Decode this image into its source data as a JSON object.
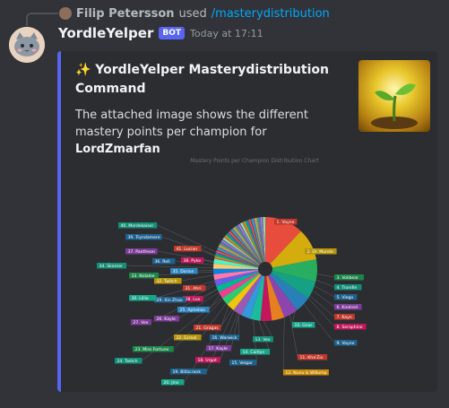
{
  "reply": {
    "user": "Filip Petersson",
    "used": "used",
    "command": "/masterydistribution"
  },
  "message": {
    "username": "YordleYelper",
    "badge": "BOT",
    "timestamp": "Today at 17:11"
  },
  "embed": {
    "accent_color": "#5865f2",
    "title": "✨ YordleYelper Masterydistribution Command",
    "description_prefix": "The attached image shows the different mastery points per champion for ",
    "summoner": "LordZmarfan"
  },
  "chart_data": {
    "type": "pie",
    "title": "Mastery Points per Champion Distribution Chart",
    "labels": [
      {
        "text": "1. Vayne",
        "color": "#c0392b"
      },
      {
        "text": "2. Dr. Mundo",
        "color": "#b7950b"
      },
      {
        "text": "3. Volibear",
        "color": "#1e8449"
      },
      {
        "text": "4. Trundle",
        "color": "#148f77"
      },
      {
        "text": "5. Viego",
        "color": "#1f618d"
      },
      {
        "text": "6. Kindred",
        "color": "#7d3c98"
      },
      {
        "text": "7. Kayn",
        "color": "#c0392b"
      },
      {
        "text": "8. Seraphine",
        "color": "#c2185b"
      },
      {
        "text": "9. Vayne",
        "color": "#1f618d"
      },
      {
        "text": "10. Gnar",
        "color": "#17a589"
      },
      {
        "text": "11. Kha'Zix",
        "color": "#c0392b"
      },
      {
        "text": "12. Nunu & Willump",
        "color": "#ca8a04"
      },
      {
        "text": "13. Vex",
        "color": "#148f77"
      },
      {
        "text": "14. Caitlyn",
        "color": "#17a589"
      },
      {
        "text": "15. Veigar",
        "color": "#1f618d"
      },
      {
        "text": "16. Warwick",
        "color": "#1f618d"
      },
      {
        "text": "17. Kayle",
        "color": "#7d3c98"
      },
      {
        "text": "18. Urgot",
        "color": "#c2185b"
      },
      {
        "text": "19. Blitzcrank",
        "color": "#1f618d"
      },
      {
        "text": "20. Jinx",
        "color": "#17a589"
      },
      {
        "text": "21. Gragas",
        "color": "#c0392b"
      },
      {
        "text": "22. Ezreal",
        "color": "#b7950b"
      },
      {
        "text": "23. Miss Fortune",
        "color": "#1e8449"
      },
      {
        "text": "24. Twitch",
        "color": "#148f77"
      },
      {
        "text": "25. Aphelios",
        "color": "#2e86c1"
      },
      {
        "text": "26. Kayle",
        "color": "#7d3c98"
      },
      {
        "text": "27. Vex",
        "color": "#7d3c98"
      },
      {
        "text": "28. Lux",
        "color": "#c2185b"
      },
      {
        "text": "29. Xin Zhao",
        "color": "#1f618d"
      },
      {
        "text": "30. Lillia",
        "color": "#17a589"
      },
      {
        "text": "31. Ahri",
        "color": "#c0392b"
      },
      {
        "text": "32. Twitch",
        "color": "#b7950b"
      },
      {
        "text": "33. Nidalee",
        "color": "#1e8449"
      },
      {
        "text": "34. Skarner",
        "color": "#148f77"
      },
      {
        "text": "35. Darius",
        "color": "#2e86c1"
      },
      {
        "text": "36. Rell",
        "color": "#1f618d"
      },
      {
        "text": "37. Pantheon",
        "color": "#7d3c98"
      },
      {
        "text": "38. Pyke",
        "color": "#c2185b"
      },
      {
        "text": "39. Tryndamere",
        "color": "#1f618d"
      },
      {
        "text": "40. Mordekaiser",
        "color": "#148f77"
      },
      {
        "text": "41. Lucian",
        "color": "#c0392b"
      }
    ]
  }
}
